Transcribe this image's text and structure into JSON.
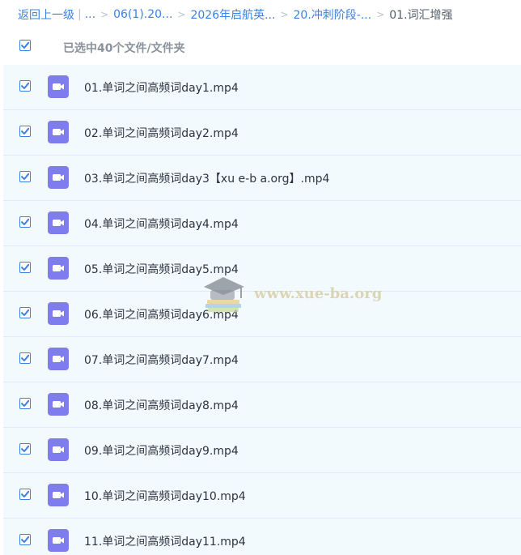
{
  "breadcrumb": {
    "back": "返回上一级",
    "pipe": "|",
    "ellipsis": "...",
    "items": [
      "06(1).20...",
      "2026年启航英...",
      "20.冲刺阶段-..."
    ],
    "current": "01.词汇增强",
    "separator": ">"
  },
  "selection": {
    "label": "已选中40个文件/文件夹",
    "all_checked": true
  },
  "files": [
    {
      "name": "01.单词之间高频词day1.mp4",
      "checked": true
    },
    {
      "name": "02.单词之间高频词day2.mp4",
      "checked": true
    },
    {
      "name": "03.单词之间高频词day3【xu e-b a.org】.mp4",
      "checked": true
    },
    {
      "name": "04.单词之间高频词day4.mp4",
      "checked": true
    },
    {
      "name": "05.单词之间高频词day5.mp4",
      "checked": true
    },
    {
      "name": "06.单词之间高频词day6.mp4",
      "checked": true
    },
    {
      "name": "07.单词之间高频词day7.mp4",
      "checked": true
    },
    {
      "name": "08.单词之间高频词day8.mp4",
      "checked": true
    },
    {
      "name": "09.单词之间高频词day9.mp4",
      "checked": true
    },
    {
      "name": "10.单词之间高频词day10.mp4",
      "checked": true
    },
    {
      "name": "11.单词之间高频词day11.mp4",
      "checked": true
    }
  ],
  "watermark": {
    "text": "www.xue-ba.org",
    "icon": "graduation-cap-books-icon"
  },
  "colors": {
    "accent": "#3a82e4",
    "video_icon": "#7f7cf0",
    "list_bg": "#f3fafe"
  }
}
